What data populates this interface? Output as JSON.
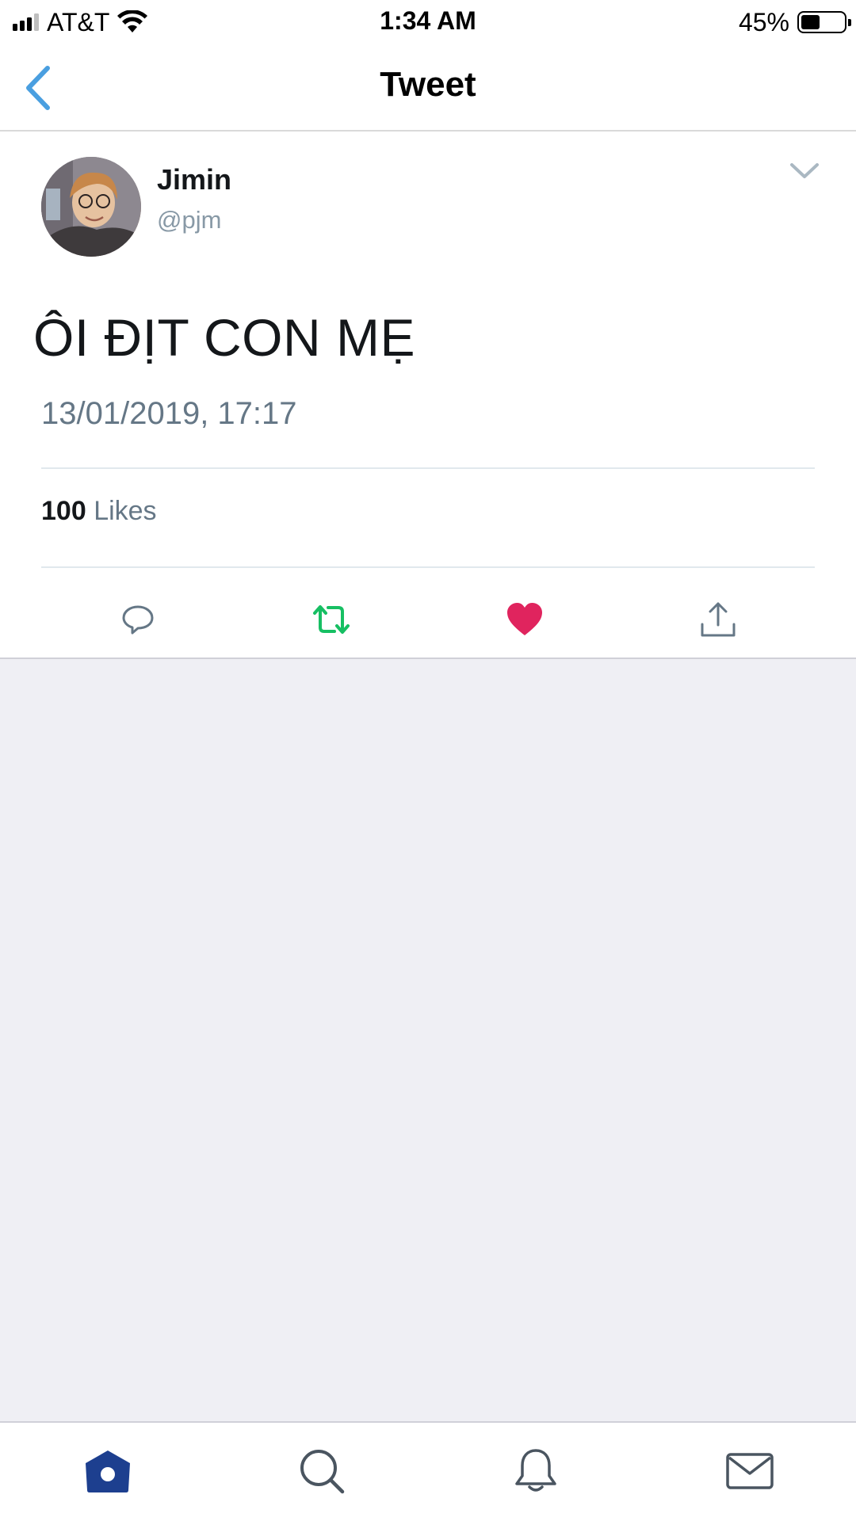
{
  "status_bar": {
    "carrier": "AT&T",
    "time": "1:34 AM",
    "battery_percent": "45%",
    "battery_level": 0.45,
    "icons": [
      "signal-icon",
      "wifi-icon",
      "battery-icon"
    ]
  },
  "nav": {
    "title": "Tweet",
    "back_icon": "chevron-left-icon",
    "accent_color": "#4a9fe0"
  },
  "tweet": {
    "display_name": "Jimin",
    "handle": "@pjm",
    "text": "ÔI ĐỊT CON MẸ",
    "timestamp": "13/01/2019, 17:17",
    "likes_count": "100",
    "likes_label": "Likes",
    "menu_icon": "chevron-down-icon",
    "liked": true
  },
  "actions": [
    {
      "name": "reply",
      "icon": "reply-icon",
      "color": "#657786"
    },
    {
      "name": "retweet",
      "icon": "retweet-icon",
      "color": "#17bf63"
    },
    {
      "name": "like",
      "icon": "heart-icon",
      "color": "#e0245e"
    },
    {
      "name": "share",
      "icon": "share-icon",
      "color": "#657786"
    }
  ],
  "tab_bar": [
    {
      "name": "home",
      "icon": "home-icon",
      "active": true,
      "color": "#1d3f8f"
    },
    {
      "name": "search",
      "icon": "search-icon",
      "active": false,
      "color": "#4a5560"
    },
    {
      "name": "notifications",
      "icon": "bell-icon",
      "active": false,
      "color": "#4a5560"
    },
    {
      "name": "messages",
      "icon": "mail-icon",
      "active": false,
      "color": "#4a5560"
    }
  ]
}
